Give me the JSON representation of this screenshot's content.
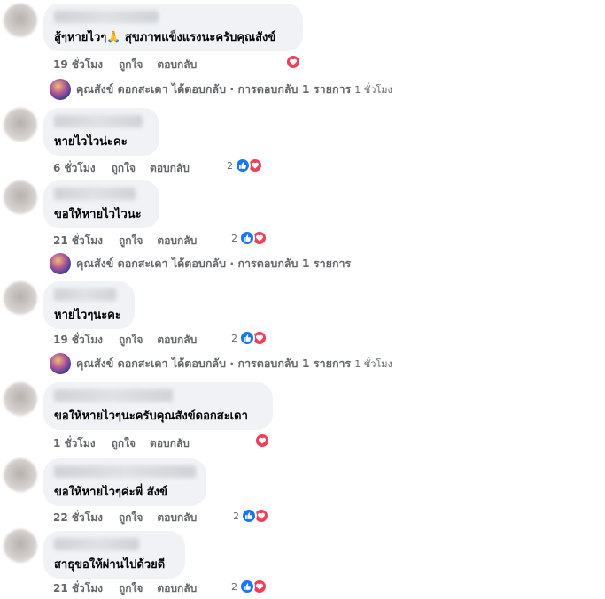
{
  "reaction_colors": {
    "like": "#1877f2",
    "love": "#f33e58"
  },
  "labels": {
    "like": "ถูกใจ",
    "reply": "ตอบกลับ"
  },
  "comments": [
    {
      "text": "สู้ๆหายไวๆ🙏 สุขภาพแข็งแรงนะครับคุณสังข์",
      "time": "19 ชั่วโมง",
      "reaction_count": ""
    },
    {
      "text": "หายไวไวน่ะคะ",
      "time": "6 ชั่วโมง",
      "reaction_count": "2"
    },
    {
      "text": "ขอให้หายไวไวนะ",
      "time": "21 ชั่วโมง",
      "reaction_count": "2"
    },
    {
      "text": "หายไวๆนะคะ",
      "time": "19 ชั่วโมง",
      "reaction_count": "2"
    },
    {
      "text": "ขอให้หายไวๆนะครับคุณสังข์ดอกสะเดา",
      "time": "1 ชั่วโมง",
      "reaction_count": ""
    },
    {
      "text": "ขอให้หายไวๆค่ะพี่ สังข์",
      "time": "22 ชั่วโมง",
      "reaction_count": "2"
    },
    {
      "text": "สาธุขอให้ผ่านไปด้วยดี",
      "time": "21 ชั่วโมง",
      "reaction_count": "2"
    }
  ],
  "replies": [
    {
      "text": "คุณสังข์ ดอกสะเดา ได้ตอบกลับ · การตอบกลับ 1 รายการ",
      "ago": "1 ชั่วโมง"
    },
    {
      "text": "คุณสังข์ ดอกสะเดา ได้ตอบกลับ · การตอบกลับ 1 รายการ",
      "ago": ""
    },
    {
      "text": "คุณสังข์ ดอกสะเดา ได้ตอบกลับ · การตอบกลับ 1 รายการ",
      "ago": "1 ชั่วโมง"
    }
  ]
}
